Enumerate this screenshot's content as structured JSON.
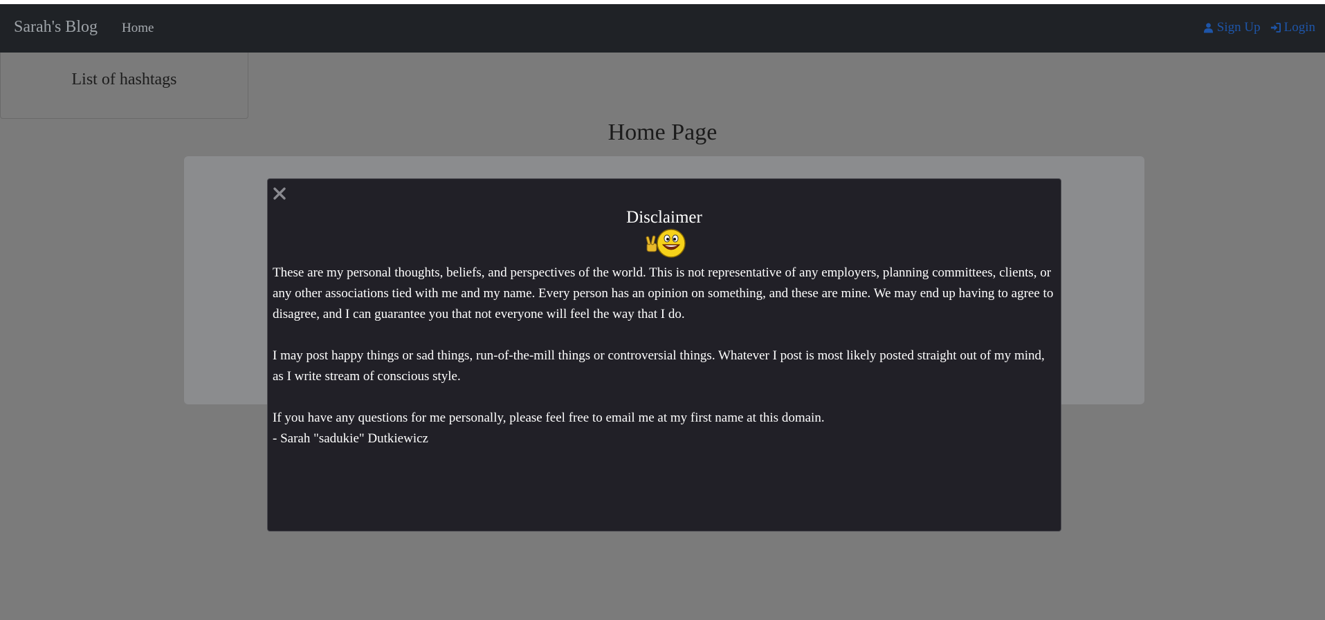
{
  "navbar": {
    "brand": "Sarah's Blog",
    "home": "Home",
    "signup": "Sign Up",
    "login": "Login",
    "link_color": "#1e55a8",
    "background": "#1f2226"
  },
  "sidebar": {
    "title": "List of hashtags"
  },
  "main": {
    "title": "Home Page"
  },
  "modal": {
    "title": "Disclaimer",
    "close_icon": "close-icon",
    "emoji": "peace-and-smiley-emoji",
    "paragraphs": [
      "These are my personal thoughts, beliefs, and perspectives of the world. This is not representative of any employers, planning committees, clients, or any other associations tied with me and my name. Every person has an opinion on something, and these are mine. We may end up having to agree to disagree, and I can guarantee you that not everyone will feel the way that I do.",
      "I may post happy things or sad things, run-of-the-mill things or controversial things. Whatever I post is most likely posted straight out of my mind, as I write stream of conscious style.",
      "If you have any questions for me personally, please feel free to email me at my first name at this domain."
    ],
    "signature": "- Sarah \"sadukie\" Dutkiewicz",
    "background": "#212027"
  }
}
